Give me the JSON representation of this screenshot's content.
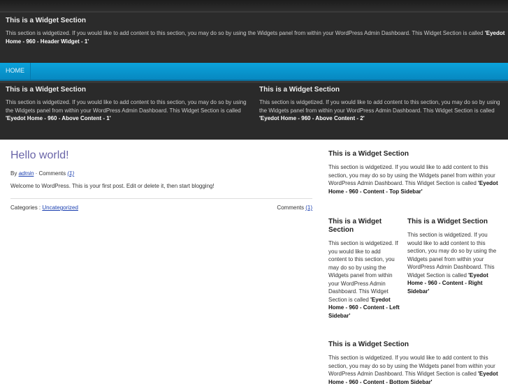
{
  "header_widget": {
    "title": "This is a Widget Section",
    "body": "This section is widgetized. If you would like to add content to this section, you may do so by using the Widgets panel from within your WordPress Admin Dashboard. This Widget Section is called ",
    "name": "'Eyedot Home - 960 - Header Widget - 1'"
  },
  "nav": {
    "items": [
      {
        "label": "HOME"
      }
    ]
  },
  "above_content": [
    {
      "title": "This is a Widget Section",
      "body": "This section is widgetized. If you would like to add content to this section, you may do so by using the Widgets panel from within your WordPress Admin Dashboard. This Widget Section is called ",
      "name": "'Eyedot Home - 960 - Above Content - 1'"
    },
    {
      "title": "This is a Widget Section",
      "body": "This section is widgetized. If you would like to add content to this section, you may do so by using the Widgets panel from within your WordPress Admin Dashboard. This Widget Section is called ",
      "name": "'Eyedot Home - 960 - Above Content - 2'"
    }
  ],
  "post": {
    "title": "Hello world!",
    "by": "By ",
    "author": "admin",
    "sep": " · Comments ",
    "comments_link": "(1)",
    "excerpt": "Welcome to WordPress. This is your first post. Edit or delete it, then start blogging!",
    "categories_label": "Categories : ",
    "category": "Uncategorized",
    "comments_label": "Comments ",
    "comments_count": "(1)"
  },
  "sidebar": {
    "top": {
      "title": "This is a Widget Section",
      "body": "This section is widgetized. If you would like to add content to this section, you may do so by using the Widgets panel from within your WordPress Admin Dashboard. This Widget Section is called ",
      "name": "'Eyedot Home - 960 - Content - Top Sidebar'"
    },
    "left": {
      "title": "This is a Widget Section",
      "body": "This section is widgetized. If you would like to add content to this section, you may do so by using the Widgets panel from within your WordPress Admin Dashboard. This Widget Section is called ",
      "name": "'Eyedot Home - 960 - Content - Left Sidebar'"
    },
    "right": {
      "title": "This is a Widget Section",
      "body": "This section is widgetized. If you would like to add content to this section, you may do so by using the Widgets panel from within your WordPress Admin Dashboard. This Widget Section is called ",
      "name": "'Eyedot Home - 960 - Content - Right Sidebar'"
    },
    "bottom": {
      "title": "This is a Widget Section",
      "body": "This section is widgetized. If you would like to add content to this section, you may do so by using the Widgets panel from within your WordPress Admin Dashboard. This Widget Section is called ",
      "name": "'Eyedot Home - 960 - Content - Bottom Sidebar'"
    }
  }
}
